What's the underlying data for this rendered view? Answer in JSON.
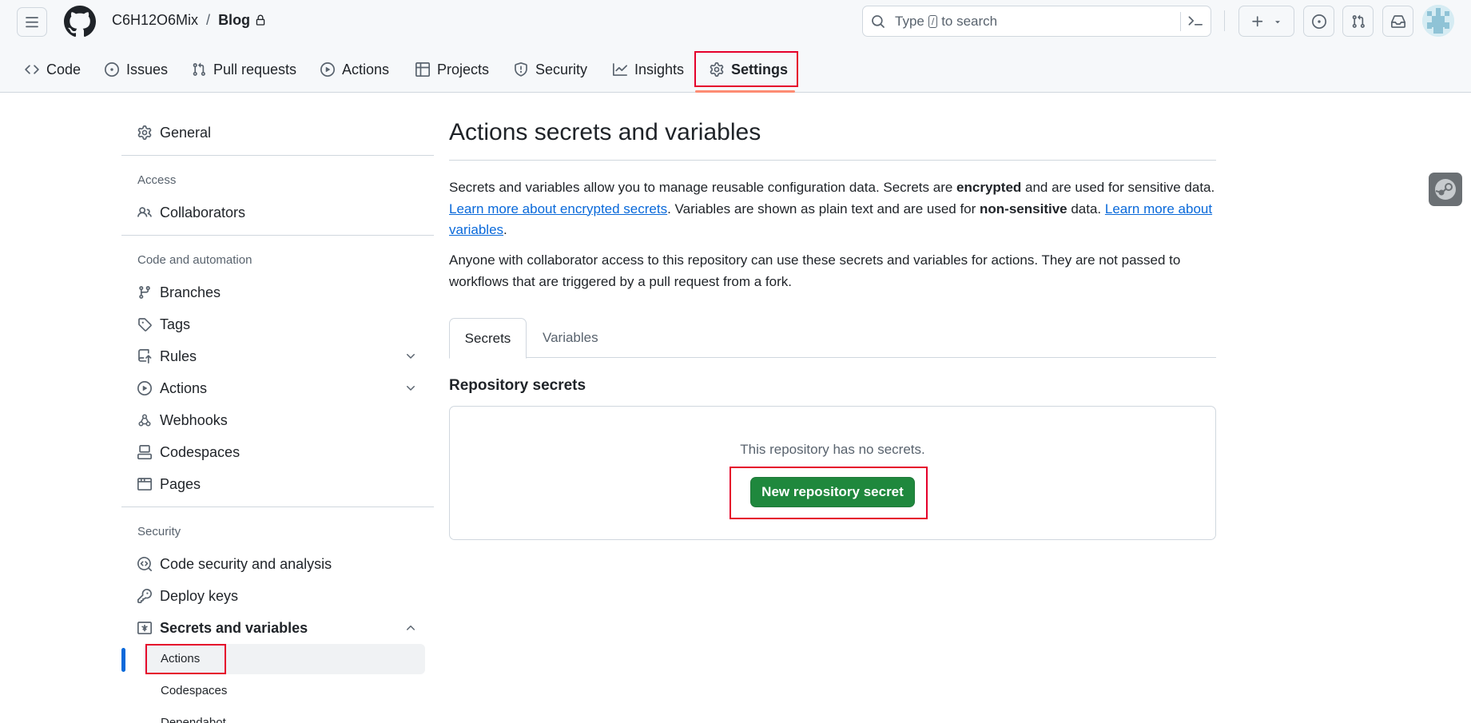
{
  "header": {
    "owner": "C6H12O6Mix",
    "separator": "/",
    "repo": "Blog",
    "search_prefix": "Type",
    "search_key": "/",
    "search_suffix": "to search"
  },
  "nav": {
    "tabs": [
      "Code",
      "Issues",
      "Pull requests",
      "Actions",
      "Projects",
      "Security",
      "Insights",
      "Settings"
    ],
    "active": "Settings"
  },
  "sidebar": {
    "general": "General",
    "access_heading": "Access",
    "collaborators": "Collaborators",
    "code_heading": "Code and automation",
    "branches": "Branches",
    "tags": "Tags",
    "rules": "Rules",
    "actions": "Actions",
    "webhooks": "Webhooks",
    "codespaces": "Codespaces",
    "pages": "Pages",
    "security_heading": "Security",
    "code_security": "Code security and analysis",
    "deploy_keys": "Deploy keys",
    "secrets": "Secrets and variables",
    "sub_actions": "Actions",
    "sub_codespaces": "Codespaces",
    "sub_dependabot": "Dependabot"
  },
  "main": {
    "title": "Actions secrets and variables",
    "p1_a": "Secrets and variables allow you to manage reusable configuration data. Secrets are ",
    "p1_b": "encrypted",
    "p1_c": " and are used for sensitive data. ",
    "p1_link1": "Learn more about encrypted secrets",
    "p1_d": ". Variables are shown as plain text and are used for ",
    "p1_e": "non-sensitive",
    "p1_f": " data. ",
    "p1_link2": "Learn more about variables",
    "p1_g": ".",
    "p2": "Anyone with collaborator access to this repository can use these secrets and variables for actions. They are not passed to workflows that are triggered by a pull request from a fork.",
    "tab_secrets": "Secrets",
    "tab_variables": "Variables",
    "section_title": "Repository secrets",
    "empty_text": "This repository has no secrets.",
    "new_secret_button": "New repository secret"
  }
}
